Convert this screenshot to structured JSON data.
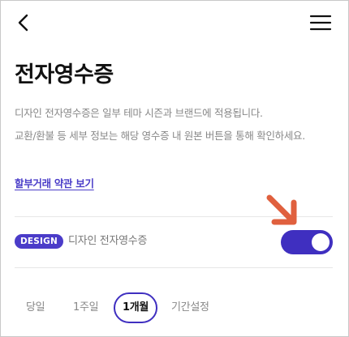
{
  "header": {
    "back_icon": "chevron-left-icon",
    "menu_icon": "hamburger-menu-icon"
  },
  "page": {
    "title": "전자영수증",
    "description_line1": "디자인 전자영수증은 일부 테마 시즌과 브랜드에 적용됩니다.",
    "description_line2": "교환/환불 등 세부 정보는 해당 영수증 내 원본 버튼을 통해 확인하세요.",
    "terms_link": "할부거래 약관 보기"
  },
  "design_setting": {
    "badge": "DESIGN",
    "label": "디자인 전자영수증",
    "toggle_on": true
  },
  "period_tabs": {
    "items": [
      "당일",
      "1주일",
      "1개월",
      "기간설정"
    ],
    "selected": "1개월"
  },
  "colors": {
    "accent": "#3f2fc0",
    "badge": "#4b3cc9",
    "link": "#4a3dc8",
    "annotation_arrow": "#e0603e"
  }
}
